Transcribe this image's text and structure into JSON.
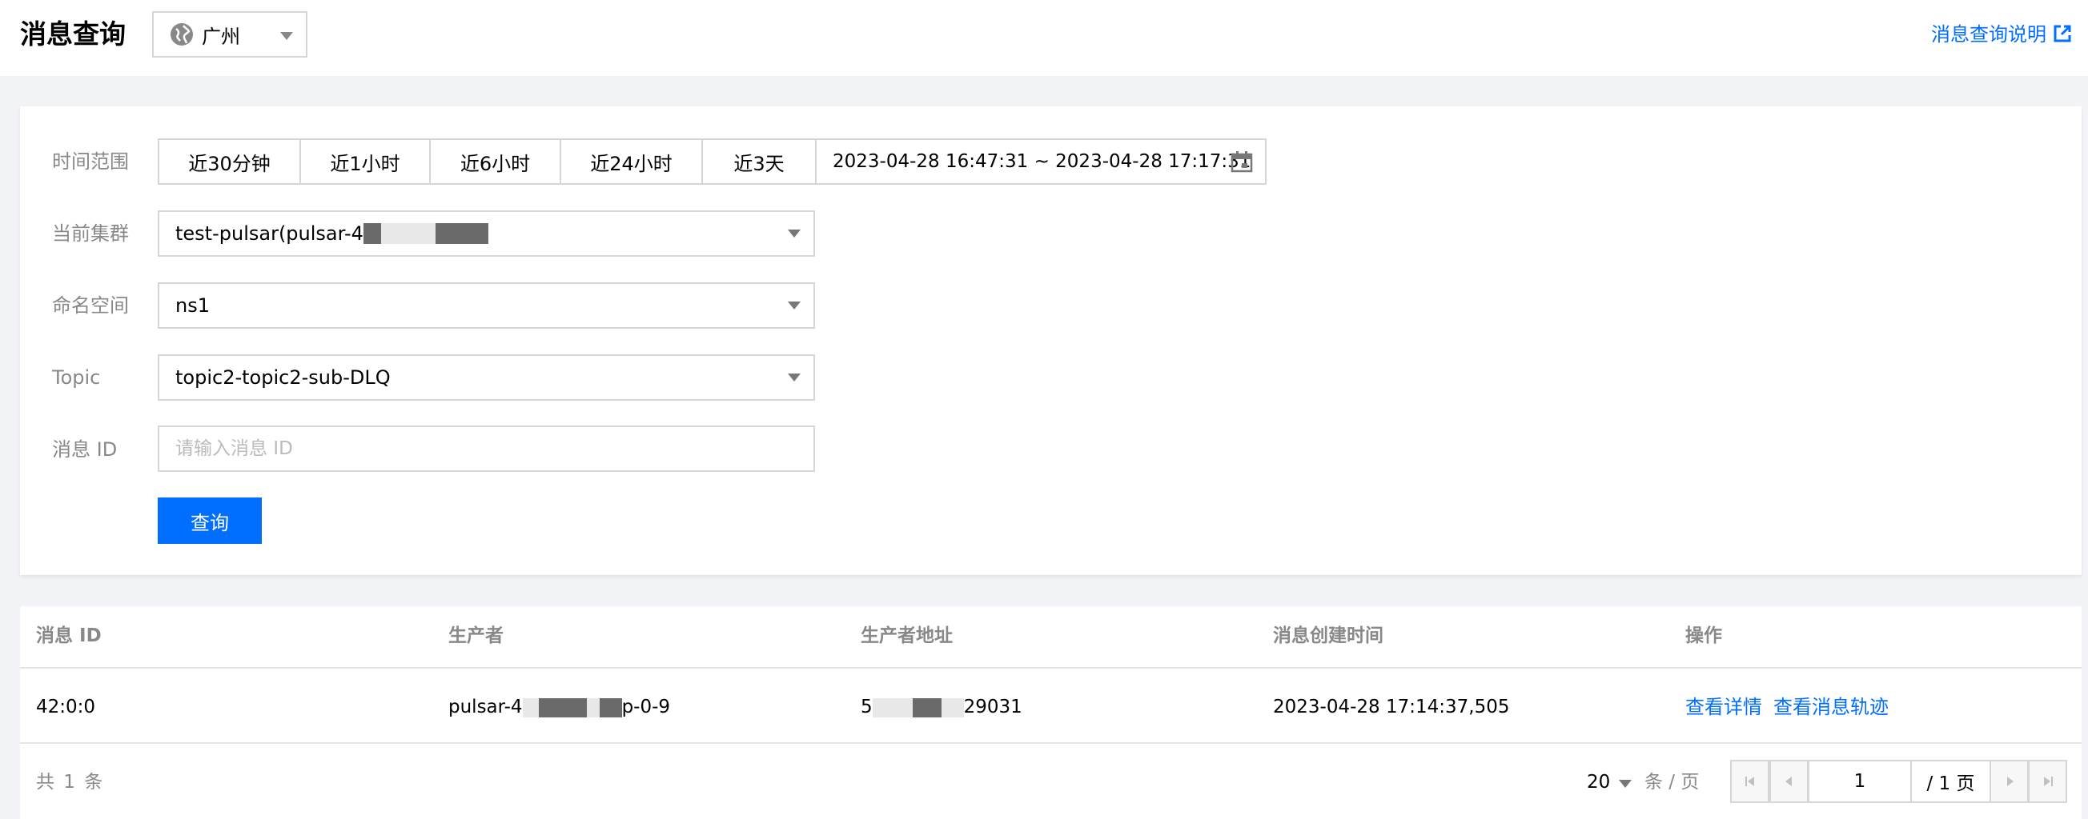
{
  "header": {
    "title": "消息查询",
    "region": "广州",
    "help_link": "消息查询说明"
  },
  "filters": {
    "time_label": "时间范围",
    "time_presets": [
      "近30分钟",
      "近1小时",
      "近6小时",
      "近24小时",
      "近3天"
    ],
    "time_range": "2023-04-28 16:47:31 ~ 2023-04-28 17:17:31",
    "cluster_label": "当前集群",
    "cluster_value": "test-pulsar(pulsar-4",
    "namespace_label": "命名空间",
    "namespace_value": "ns1",
    "topic_label": "Topic",
    "topic_value": "topic2-topic2-sub-DLQ",
    "message_id_label": "消息 ID",
    "message_id_placeholder": "请输入消息 ID",
    "query_button": "查询"
  },
  "table": {
    "columns": [
      "消息 ID",
      "生产者",
      "生产者地址",
      "消息创建时间",
      "操作"
    ],
    "rows": [
      {
        "message_id": "42:0:0",
        "producer_prefix": "pulsar-4",
        "producer_suffix": "p-0-9",
        "address_prefix": "5",
        "address_suffix": "29031",
        "created_at": "2023-04-28 17:14:37,505",
        "actions": [
          "查看详情",
          "查看消息轨迹"
        ]
      }
    ]
  },
  "pagination": {
    "total_text": "共 1 条",
    "page_size": "20",
    "per_page_text": "条 / 页",
    "current_page": "1",
    "total_pages_text": "/ 1 页"
  },
  "colors": {
    "accent": "#006eff",
    "background": "#f2f3f7"
  }
}
